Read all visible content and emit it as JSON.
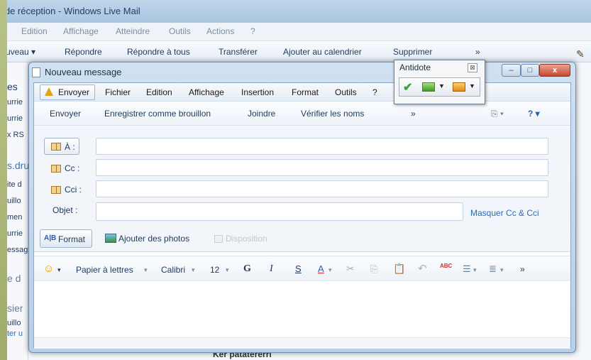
{
  "background_window": {
    "title": "e de réception - Windows Live Mail",
    "menu": [
      "Edition",
      "Affichage",
      "Atteindre",
      "Outils",
      "Actions",
      "?"
    ],
    "toolbar": [
      "uveau ▾",
      "Répondre",
      "Répondre à tous",
      "Transférer",
      "Ajouter au calendrier",
      "Supprimer",
      "»"
    ],
    "left_pane": [
      "es",
      "urrie",
      "urrie",
      "x RS",
      "s.dru",
      "ite d",
      "uillo",
      "men",
      "urrie",
      "essag",
      "e d",
      "sier",
      "uillo",
      "ter u"
    ],
    "bottom_text": "Ker patatererri"
  },
  "compose": {
    "title": "Nouveau message",
    "window_buttons": {
      "minimize": "–",
      "maximize": "□",
      "close": "x"
    },
    "menu": {
      "send": "Envoyer",
      "items": [
        "Fichier",
        "Edition",
        "Affichage",
        "Insertion",
        "Format",
        "Outils",
        "?"
      ]
    },
    "toolbar": {
      "send": "Envoyer",
      "save_draft": "Enregistrer comme brouillon",
      "attach": "Joindre",
      "check_names": "Vérifier les noms",
      "more": "»",
      "view_icon": "⎘ ▾",
      "help_icon": "? ▾"
    },
    "fields": {
      "to_label": "À :",
      "cc_label": "Cc :",
      "bcc_label": "Cci :",
      "subject_label": "Objet :",
      "to_value": "",
      "cc_value": "",
      "bcc_value": "",
      "subject_value": "",
      "hide_cc": "Masquer Cc & Cci"
    },
    "actions": {
      "format": "Format",
      "format_icon_text": "A|B",
      "add_photos": "Ajouter des photos",
      "layout": "Disposition"
    },
    "format_bar": {
      "emoticon": "☺",
      "stationery": "Papier à lettres",
      "font": "Calibri",
      "size": "12",
      "bold": "G",
      "italic": "I",
      "underline": "S",
      "font_color": "A",
      "spell_icon": "ABC",
      "more": "»"
    }
  },
  "antidote": {
    "title": "Antidote",
    "close": "⊠",
    "check_icon": "✔"
  }
}
